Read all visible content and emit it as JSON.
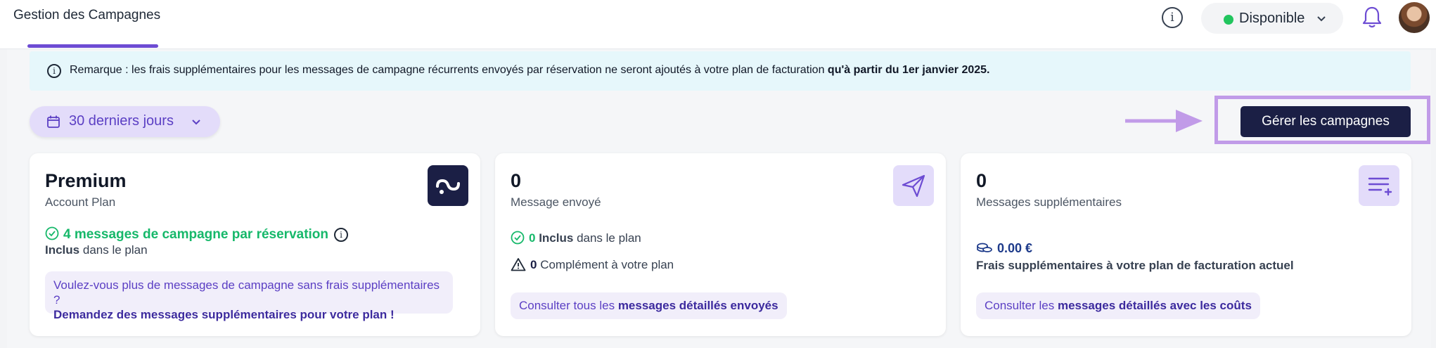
{
  "header": {
    "title": "Gestion des Campagnes",
    "info_icon": "info-circle-icon",
    "status": {
      "label": "Disponible",
      "dot_color": "#22c55e"
    },
    "bell_icon": "bell-icon",
    "avatar": "user-avatar"
  },
  "notice": {
    "icon": "info-circle-icon",
    "text": "Remarque : les frais supplémentaires pour les messages de campagne récurrents envoyés par réservation ne seront ajoutés à votre plan de facturation",
    "bold": "qu'à partir du 1er janvier 2025."
  },
  "filters": {
    "date_range": "30 derniers jours",
    "calendar_icon": "calendar-icon"
  },
  "actions": {
    "manage_label": "Gérer les campagnes",
    "arrow_icon": "arrow-right-icon",
    "highlight_color": "#c19be8"
  },
  "cards": {
    "plan": {
      "title": "Premium",
      "subtitle": "Account Plan",
      "icon": "brand-logo-icon",
      "feature": "4 messages de campagne par réservation",
      "included_bold": "Inclus",
      "included_rest": "dans le plan",
      "upsell_text": "Voulez-vous plus de messages de campagne sans frais supplémentaires ?",
      "upsell_link": "Demandez des messages supplémentaires pour votre plan !"
    },
    "sent": {
      "value": "0",
      "label": "Message envoyé",
      "icon": "send-icon",
      "included_value": "0",
      "included_bold": "Inclus",
      "included_rest": "dans le plan",
      "extra_value": "0",
      "extra_rest": "Complément à votre plan",
      "link_prefix": "Consulter tous les",
      "link_bold": "messages détaillés envoyés"
    },
    "extra": {
      "value": "0",
      "label": "Messages supplémentaires",
      "icon": "list-add-icon",
      "amount": "0.00 €",
      "amount_desc": "Frais supplémentaires à votre plan de facturation actuel",
      "link_prefix": "Consulter les",
      "link_bold": "messages détaillés avec les coûts"
    }
  },
  "colors": {
    "accent": "#6d4cd3",
    "navy": "#1b1f45",
    "green": "#16b86a",
    "notice_bg": "#e6f7fb"
  }
}
